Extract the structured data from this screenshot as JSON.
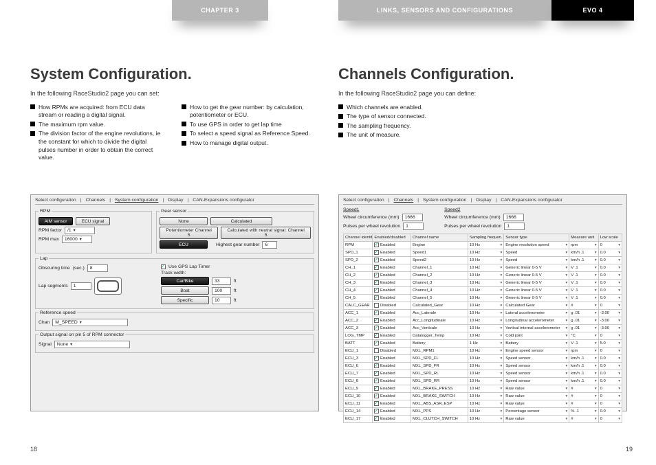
{
  "header": {
    "chapter": "CHAPTER 3",
    "mid": "LINKS, SENSORS AND CONFIGURATIONS",
    "right": "EVO 4"
  },
  "left": {
    "title": "System Configuration.",
    "intro": "In the following RaceStudio2 page you can set:",
    "col1": [
      "How RPMs are acquired: from ECU data stream or reading a digital signal.",
      "The maximum rpm value.",
      "The division factor of the engine revolutions, ie the constant for which to divide the digital pulses number in order to obtain the correct value."
    ],
    "col2": [
      "How to get the gear number: by calculation, potentiometer or ECU.",
      "To use GPS in order to get lap time",
      "To select a speed signal as Reference Speed.",
      "How to manage digital output."
    ],
    "tabs": [
      "Select configuration",
      "Channels",
      "System configuration",
      "Display",
      "CAN-Expansions configurator"
    ],
    "tab_selected": 2,
    "rpm": {
      "legend": "RPM",
      "aim": "AIM sensor",
      "ecu": "ECU signal",
      "factor_lbl": "RPM factor",
      "factor_val": "/1",
      "max_lbl": "RPM max",
      "max_val": "16000"
    },
    "gear": {
      "legend": "Gear sensor",
      "none": "None",
      "calc": "Calculated",
      "pot": "Potentiometer Channel 5",
      "calc_n": "Calculated with neutral signal: Channel 5",
      "ecu": "ECU",
      "hg_lbl": "Highest gear number",
      "hg_val": "6"
    },
    "lap": {
      "legend": "Lap",
      "use_gps": "Use GPS Lap Timer",
      "obs_lbl": "Obscuring time",
      "obs_unit": "(sec.)",
      "obs_val": "8",
      "seg_lbl": "Lap segments",
      "seg_val": "1",
      "tw_lbl": "Track width:",
      "rows": [
        [
          "Car/Bike",
          "33",
          "ft"
        ],
        [
          "Boat",
          "100",
          "ft"
        ],
        [
          "Specific",
          "10",
          "ft"
        ]
      ]
    },
    "ref": {
      "legend": "Reference speed",
      "chan_lbl": "Chan",
      "chan_val": "M_SPEED"
    },
    "out": {
      "legend": "Output signal on pin 5 of RPM connector",
      "sig_lbl": "Signal",
      "sig_val": "None"
    }
  },
  "right": {
    "title": "Channels Configuration.",
    "intro": "In the following RaceStudio2 page you can define:",
    "bullets": [
      "Which channels are enabled.",
      "The type of sensor connected.",
      "The sampling frequency.",
      "The unit of measure."
    ],
    "tabs": [
      "Select configuration",
      "Channels",
      "System configuration",
      "Display",
      "CAN-Expansions configurator"
    ],
    "tab_selected": 1,
    "speedline": {
      "sp_lbl": "Speed1",
      "wc_lbl": "Wheel circumference (mm)",
      "wc_val": "1666",
      "wc2_lbl": "Wheel circumference (mm)",
      "wc2_val": "1666",
      "pw_lbl": "Pulses per wheel revolution",
      "pw_val": "1",
      "pw2_lbl": "Pulses per wheel revolution",
      "pw2_val": "1",
      "sp2_lbl": "Speed2"
    },
    "headers": [
      "Channel identif.",
      "Enabled/disabled",
      "Channel name",
      "Sampling frequen.",
      "Sensor type",
      "Measure unit",
      "Low scale"
    ],
    "rows": [
      [
        "RPM",
        "Enabled",
        "Engine",
        "10 Hz",
        "Engine revolution speed",
        "rpm",
        "0"
      ],
      [
        "SPD_1",
        "Enabled",
        "Speed1",
        "10 Hz",
        "Speed",
        "km/h .1",
        "0.0"
      ],
      [
        "SPD_2",
        "Enabled",
        "Speed2",
        "10 Hz",
        "Speed",
        "km/h .1",
        "0.0"
      ],
      [
        "CH_1",
        "Enabled",
        "Channel_1",
        "10 Hz",
        "Generic linear 0-5 V",
        "V .1",
        "0.0"
      ],
      [
        "CH_2",
        "Enabled",
        "Channel_2",
        "10 Hz",
        "Generic linear 0-5 V",
        "V .1",
        "0.0"
      ],
      [
        "CH_3",
        "Enabled",
        "Channel_3",
        "10 Hz",
        "Generic linear 0-5 V",
        "V .1",
        "0.0"
      ],
      [
        "CH_4",
        "Enabled",
        "Channel_4",
        "10 Hz",
        "Generic linear 0-5 V",
        "V .1",
        "0.0"
      ],
      [
        "CH_5",
        "Enabled",
        "Channel_5",
        "10 Hz",
        "Generic linear 0-5 V",
        "V .1",
        "0.0"
      ],
      [
        "CALC_GEAR",
        "Disabled",
        "Calculated_Gear",
        "10 Hz",
        "Calculated Gear",
        "#",
        "0"
      ],
      [
        "ACC_1",
        "Enabled",
        "Acc_Laterale",
        "10 Hz",
        "Lateral accelerometer",
        "g .01",
        "-3.00"
      ],
      [
        "ACC_2",
        "Enabled",
        "Acc_Longitudinale",
        "10 Hz",
        "Longitudinal accelerometer",
        "g .01",
        "-3.00"
      ],
      [
        "ACC_3",
        "Enabled",
        "Acc_Verticale",
        "10 Hz",
        "Vertical internal accelerometer",
        "g .01",
        "-3.00"
      ],
      [
        "LOG_TMP",
        "Enabled",
        "Datalogger_Temp",
        "10 Hz",
        "Cold joint",
        "°C",
        "0"
      ],
      [
        "BATT",
        "Enabled",
        "Battery",
        "1 Hz",
        "Battery",
        "V .1",
        "5.0"
      ],
      [
        "ECU_1",
        "Disabled",
        "MXL_RPM1",
        "10 Hz",
        "Engine speed sensor",
        "rpm",
        "0"
      ],
      [
        "ECU_3",
        "Enabled",
        "MXL_SPD_FL",
        "10 Hz",
        "Speed sensor",
        "km/h .1",
        "0.0"
      ],
      [
        "ECU_6",
        "Enabled",
        "MXL_SPD_FR",
        "10 Hz",
        "Speed sensor",
        "km/h .1",
        "0.0"
      ],
      [
        "ECU_7",
        "Enabled",
        "MXL_SPD_RL",
        "10 Hz",
        "Speed sensor",
        "km/h .1",
        "0.0"
      ],
      [
        "ECU_8",
        "Enabled",
        "MXL_SPD_RR",
        "10 Hz",
        "Speed sensor",
        "km/h .1",
        "0.0"
      ],
      [
        "ECU_9",
        "Enabled",
        "MXL_BRAKE_PRESS",
        "10 Hz",
        "Raw value",
        "#",
        "0"
      ],
      [
        "ECU_10",
        "Enabled",
        "MXL_BRAKE_SWITCH",
        "10 Hz",
        "Raw value",
        "#",
        "0"
      ],
      [
        "ECU_11",
        "Enabled",
        "MXL_ABS_ASR_ESP",
        "10 Hz",
        "Raw value",
        "#",
        "0"
      ],
      [
        "ECU_14",
        "Enabled",
        "MXL_PPS",
        "10 Hz",
        "Percentage sensor",
        "% .1",
        "0.0"
      ],
      [
        "ECU_17",
        "Enabled",
        "MXL_CLUTCH_SWITCH",
        "10 Hz",
        "Raw value",
        "#",
        "0"
      ]
    ]
  },
  "footer": {
    "left": "18",
    "right": "19"
  }
}
